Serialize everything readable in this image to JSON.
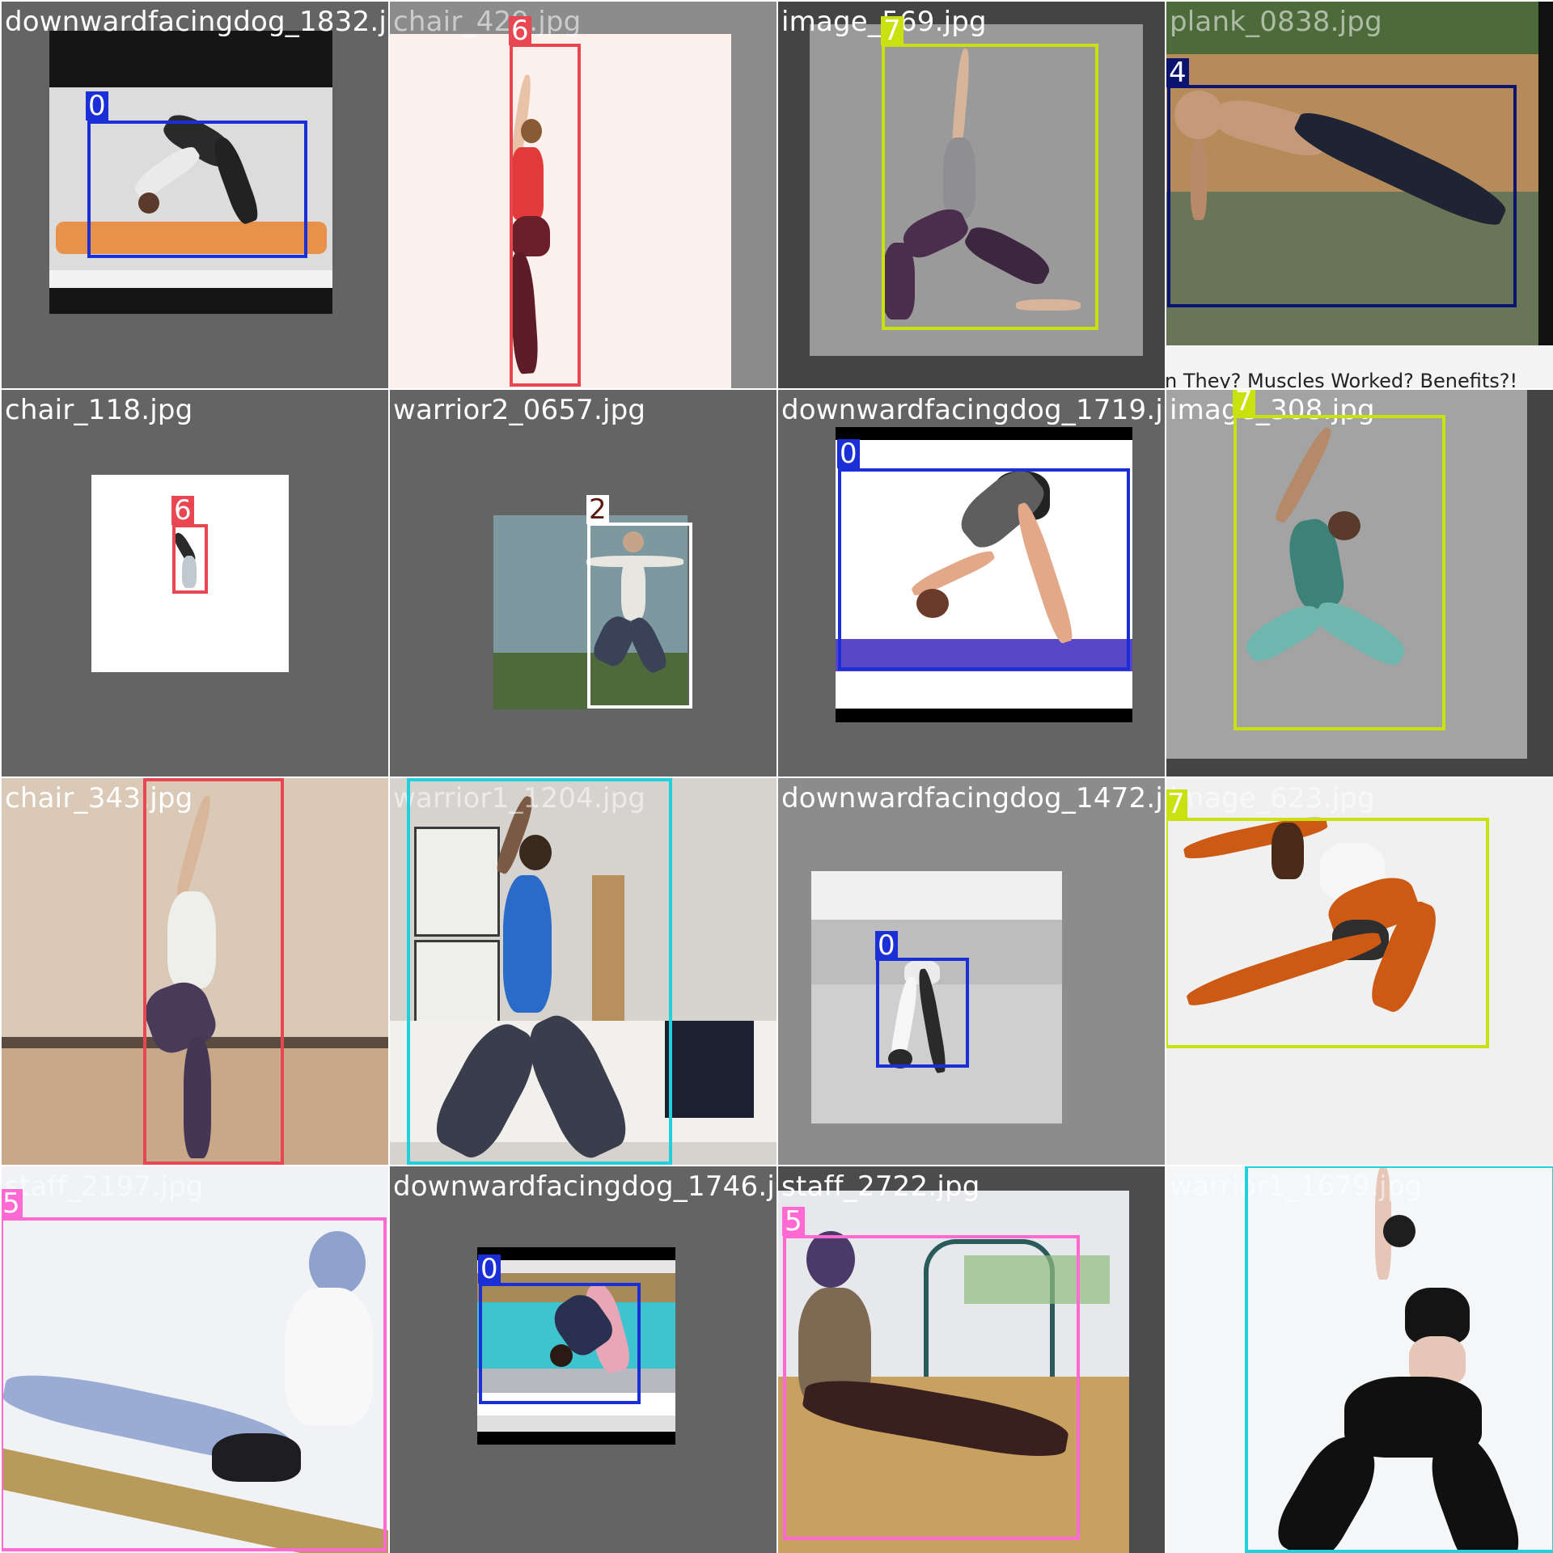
{
  "palette": {
    "0": "#1a2fd6",
    "1": "#1fd1dc",
    "2": "#ffffff",
    "4": "#0b1570",
    "5": "#ff6ad2",
    "6": "#e84752",
    "7": "#c9e10f"
  },
  "tiles": [
    {
      "filename": "downwardfacingdog_1832.jpg",
      "labels": [
        "0"
      ]
    },
    {
      "filename": "chair_429.jpg",
      "labels": [
        "6"
      ]
    },
    {
      "filename": "image_569.jpg",
      "labels": [
        "7"
      ]
    },
    {
      "filename": "plank_0838.jpg",
      "labels": [
        "4"
      ],
      "caption": "n They? Muscles Worked? Benefits?!"
    },
    {
      "filename": "chair_118.jpg",
      "labels": [
        "6"
      ]
    },
    {
      "filename": "warrior2_0657.jpg",
      "labels": [
        "2"
      ]
    },
    {
      "filename": "downwardfacingdog_1719.jpg",
      "labels": [
        "0"
      ]
    },
    {
      "filename": "image_308.jpg",
      "labels": [
        "7"
      ]
    },
    {
      "filename": "chair_343.jpg",
      "labels": [
        "6"
      ]
    },
    {
      "filename": "warrior1_1204.jpg",
      "labels": [
        "1"
      ]
    },
    {
      "filename": "downwardfacingdog_1472.jpg",
      "labels": [
        "0"
      ]
    },
    {
      "filename": "image_623.jpg",
      "labels": [
        "7"
      ]
    },
    {
      "filename": "staff_2197.jpg",
      "labels": [
        "5"
      ]
    },
    {
      "filename": "downwardfacingdog_1746.jpg",
      "labels": [
        "0"
      ]
    },
    {
      "filename": "staff_2722.jpg",
      "labels": [
        "5"
      ]
    },
    {
      "filename": "warrior1_1679.jpg",
      "labels": [
        "1"
      ]
    }
  ]
}
